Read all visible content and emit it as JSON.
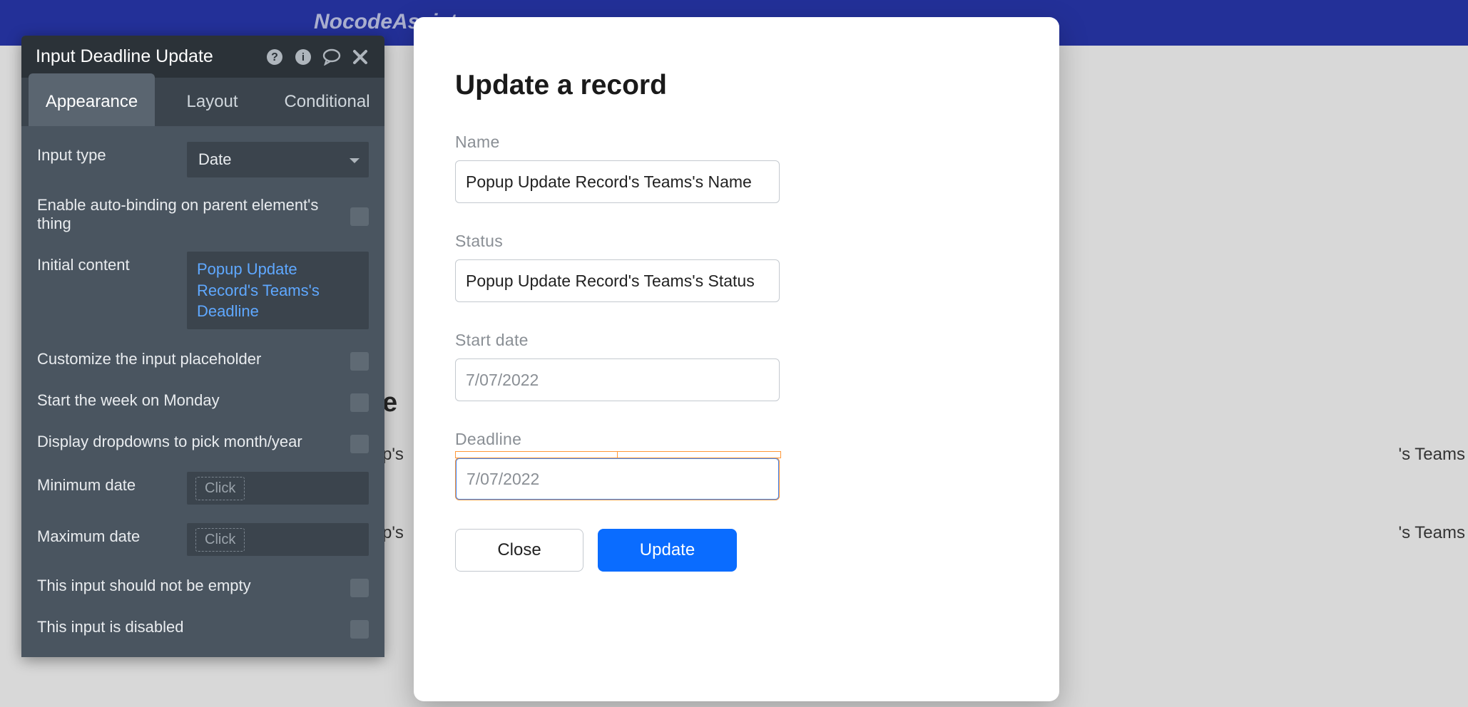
{
  "header": {
    "brand": "NocodeAssist"
  },
  "background": {
    "heading_fragment": "e",
    "cell_fragment1": "p's",
    "cell_fragment2": "p's",
    "right_fragment1": "'s Teams",
    "right_fragment2": "'s Teams"
  },
  "panel": {
    "title": "Input Deadline Update",
    "tabs": {
      "appearance": "Appearance",
      "layout": "Layout",
      "conditional": "Conditional"
    },
    "rows": {
      "input_type_label": "Input type",
      "input_type_value": "Date",
      "autobind_label": "Enable auto-binding on parent element's thing",
      "initial_content_label": "Initial content",
      "initial_content_value": "Popup Update Record's Teams's Deadline",
      "customize_placeholder_label": "Customize the input placeholder",
      "start_week_label": "Start the week on Monday",
      "display_dropdowns_label": "Display dropdowns to pick month/year",
      "min_date_label": "Minimum date",
      "max_date_label": "Maximum date",
      "click_text": "Click",
      "not_empty_label": "This input should not be empty",
      "disabled_label": "This input is disabled"
    }
  },
  "modal": {
    "title": "Update a record",
    "name_label": "Name",
    "name_value": "Popup Update Record's Teams's Name",
    "status_label": "Status",
    "status_value": "Popup Update Record's Teams's Status",
    "start_date_label": "Start date",
    "start_date_placeholder": "7/07/2022",
    "deadline_label": "Deadline",
    "deadline_placeholder": "7/07/2022",
    "close_button": "Close",
    "update_button": "Update"
  }
}
